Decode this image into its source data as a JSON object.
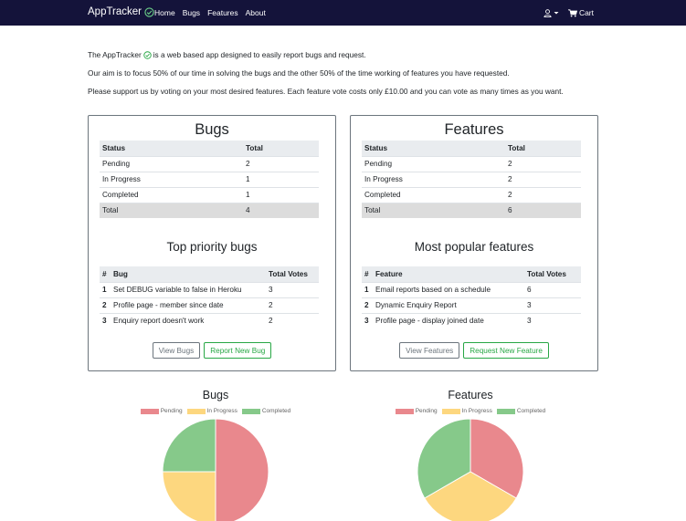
{
  "navbar": {
    "brand": "AppTracker",
    "links": [
      "Home",
      "Bugs",
      "Features",
      "About"
    ],
    "cart_label": "Cart",
    "user_icon": "user-icon",
    "cart_icon": "cart-icon"
  },
  "intro": {
    "line1_pre": "The AppTracker",
    "line1_post": "is a web based app designed to easily report bugs and request.",
    "line2": "Our aim is to focus 50% of our time in solving the bugs and the other 50% of the time working of features you have requested.",
    "line3": "Please support us by voting on your most desired features. Each feature vote costs only £10.00 and you can vote as many times as you want."
  },
  "bugs_card": {
    "title": "Bugs",
    "status_headers": [
      "Status",
      "Total"
    ],
    "status_rows": [
      {
        "status": "Pending",
        "total": "2"
      },
      {
        "status": "In Progress",
        "total": "1"
      },
      {
        "status": "Completed",
        "total": "1"
      }
    ],
    "total_row": {
      "label": "Total",
      "value": "4"
    },
    "priority_title": "Top priority bugs",
    "priority_headers": [
      "#",
      "Bug",
      "Total Votes"
    ],
    "priority_rows": [
      {
        "n": "1",
        "name": "Set DEBUG variable to false in Heroku",
        "votes": "3"
      },
      {
        "n": "2",
        "name": "Profile page - member since date",
        "votes": "2"
      },
      {
        "n": "3",
        "name": "Enquiry report doesn't work",
        "votes": "2"
      }
    ],
    "view_button": "View Bugs",
    "new_button": "Report New Bug"
  },
  "features_card": {
    "title": "Features",
    "status_headers": [
      "Status",
      "Total"
    ],
    "status_rows": [
      {
        "status": "Pending",
        "total": "2"
      },
      {
        "status": "In Progress",
        "total": "2"
      },
      {
        "status": "Completed",
        "total": "2"
      }
    ],
    "total_row": {
      "label": "Total",
      "value": "6"
    },
    "popular_title": "Most popular features",
    "popular_headers": [
      "#",
      "Feature",
      "Total Votes"
    ],
    "popular_rows": [
      {
        "n": "1",
        "name": "Email reports based on a schedule",
        "votes": "6"
      },
      {
        "n": "2",
        "name": "Dynamic Enquiry Report",
        "votes": "3"
      },
      {
        "n": "3",
        "name": "Profile page - display joined date",
        "votes": "3"
      }
    ],
    "view_button": "View Features",
    "new_button": "Request New Feature"
  },
  "colors": {
    "navbar": "#14133a",
    "pending": "#e9888d",
    "in_progress": "#fdd77f",
    "completed": "#86c98a",
    "success": "#28a745",
    "secondary": "#6c757d"
  },
  "chart_data": [
    {
      "type": "pie",
      "title": "Bugs",
      "categories": [
        "Pending",
        "In Progress",
        "Completed"
      ],
      "values": [
        2,
        1,
        1
      ],
      "colors": [
        "#e9888d",
        "#fdd77f",
        "#86c98a"
      ],
      "legend": "top"
    },
    {
      "type": "pie",
      "title": "Features",
      "categories": [
        "Pending",
        "In Progress",
        "Completed"
      ],
      "values": [
        2,
        2,
        2
      ],
      "colors": [
        "#e9888d",
        "#fdd77f",
        "#86c98a"
      ],
      "legend": "top"
    }
  ]
}
